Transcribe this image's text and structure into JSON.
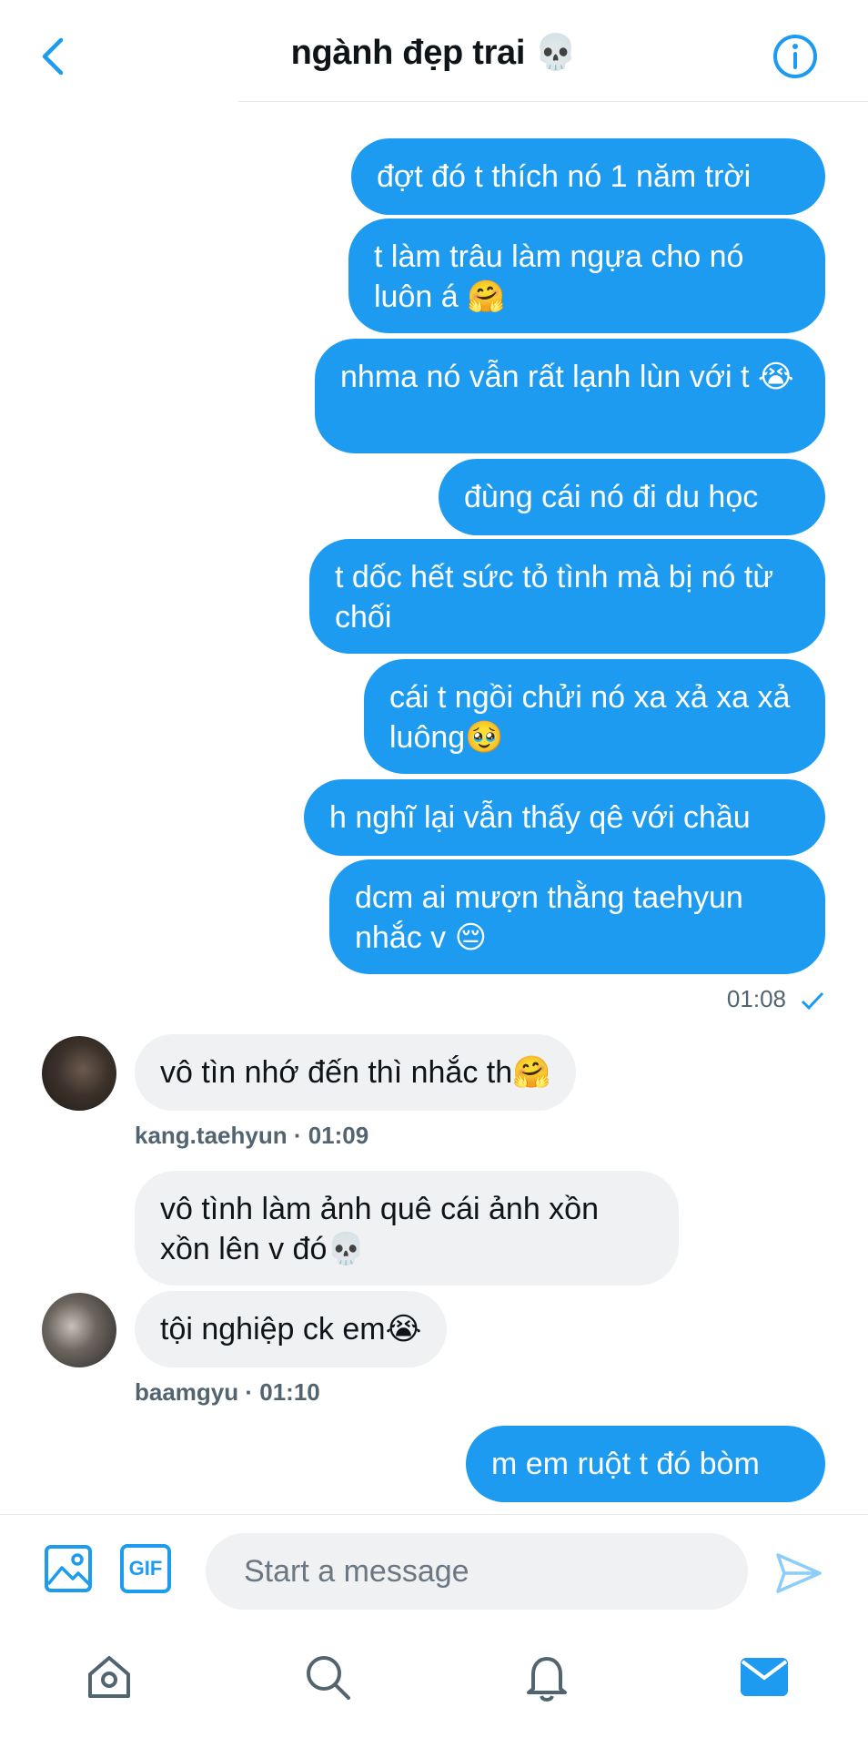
{
  "header": {
    "title": "ngành đẹp trai 💀"
  },
  "messages": [
    {
      "type": "sent",
      "text": "đợt đó t thích nó 1 năm trời"
    },
    {
      "type": "sent",
      "text": "t làm trâu làm ngựa cho nó luôn á 🤗"
    },
    {
      "type": "sent",
      "text": "nhma nó vẫn rất lạnh lùn với t 😭"
    },
    {
      "type": "sent",
      "text": "đùng cái nó đi du học"
    },
    {
      "type": "sent",
      "text": "t dốc hết sức tỏ tình mà bị nó từ chối"
    },
    {
      "type": "sent",
      "text": "cái t ngồi chửi nó xa xả xa xả luông🥹"
    },
    {
      "type": "sent",
      "text": "h nghĩ lại vẫn thấy qê với chầu"
    },
    {
      "type": "sent",
      "text": "dcm ai mượn thằng taehyun nhắc v 😔"
    },
    {
      "type": "received",
      "text": "vô tìn nhớ đến thì nhắc th🤗"
    },
    {
      "type": "received",
      "text": "vô tình làm ảnh quê cái ảnh xồn xồn lên v đó💀"
    },
    {
      "type": "received",
      "text": "tội nghiệp ck em😭"
    },
    {
      "type": "sent",
      "text": "m em ruột t đó bòm"
    }
  ],
  "meta": {
    "sent_time": "01:08",
    "user1_meta": "kang.taehyun · 01:09",
    "user2_meta": "baamgyu · 01:10"
  },
  "composer": {
    "placeholder": "Start a message",
    "gif_label": "GIF"
  },
  "colors": {
    "accent": "#1d9bf0",
    "received_bubble": "#eff1f3"
  },
  "icons": {
    "back": "chevron-left-icon",
    "info": "info-icon",
    "image": "image-icon",
    "send": "send-icon",
    "home": "home-icon",
    "search": "search-icon",
    "notifications": "bell-icon",
    "messages": "mail-icon"
  }
}
